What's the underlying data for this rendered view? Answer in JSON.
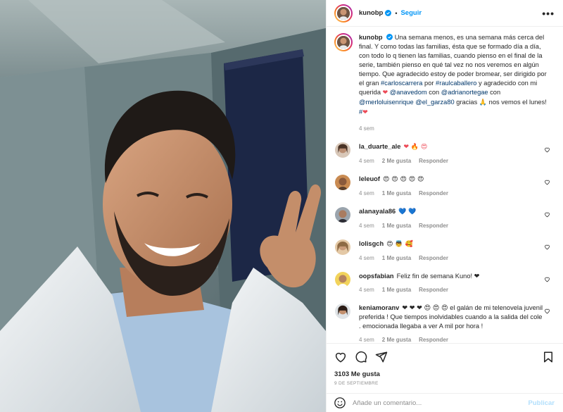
{
  "post": {
    "username": "kunobp",
    "follow_label": "Seguir",
    "separator": "•",
    "more_label": "•••",
    "caption": {
      "text_before": "Una semana menos, es una semana más cerca del final. Y como todas las familias, ésta que se formado día a día, con todo lo q tienen las familias, cuando pienso en el final de la serie, también pienso en qué tal vez no nos veremos en algún tiempo. Que agradecido estoy de poder bromear, ser dirigido por el gran ",
      "mention_1": "#carloscarrera",
      "text_2": " por ",
      "mention_2": "#raulcaballero",
      "text_3": " y agradecido con mi querida ",
      "heart_1": "❤",
      "text_4": "  ",
      "mention_3": "@anavedom",
      "text_5": " con ",
      "mention_4": "@adrianortegae",
      "text_6": " con ",
      "mention_5": "@merloluisenrique",
      "text_7": " ",
      "mention_6": "@el_garza80",
      "text_8": " gracias ",
      "emoji_pray": "🙏",
      "text_9": "  nos vemos el lunes! ",
      "mention_7": "#",
      "heart_2": "❤",
      "time": "4 sem"
    },
    "comments": [
      {
        "user": "la_duarte_ale",
        "text": "❤ 🔥 😍",
        "time": "4 sem",
        "likes": "2 Me gusta",
        "reply": "Responder"
      },
      {
        "user": "leleuof",
        "text": "😍 😍 😍 😍 😍",
        "time": "4 sem",
        "likes": "1 Me gusta",
        "reply": "Responder"
      },
      {
        "user": "alanayala86",
        "text": "💙 💙",
        "time": "4 sem",
        "likes": "1 Me gusta",
        "reply": "Responder"
      },
      {
        "user": "lolisgch",
        "text": "😍 👼 🥰",
        "time": "4 sem",
        "likes": "1 Me gusta",
        "reply": "Responder"
      },
      {
        "user": "oopsfabian",
        "text": "Feliz fin de semana Kuno! ❤",
        "time": "4 sem",
        "likes": "1 Me gusta",
        "reply": "Responder"
      },
      {
        "user": "keniamoranv",
        "text": "❤ ❤ ❤ 😍 😍 😍 el galán de mi telenovela juvenil preferida ! Que tiempos inolvidables cuando a la salida del cole . emocionada llegaba a ver A mil por hora !",
        "time": "4 sem",
        "likes": "2 Me gusta",
        "reply": "Responder"
      }
    ],
    "likes_count": "3103 Me gusta",
    "date": "9 DE SEPTIEMBRE",
    "add_comment_placeholder": "Añade un comentario...",
    "publish_label": "Publicar"
  },
  "colors": {
    "link": "#00376b",
    "follow": "#0095f6",
    "heart": "#ed4956",
    "muted": "#8e8e8e",
    "publish_disabled": "#b2dffc"
  },
  "icons": [
    "heart-icon",
    "comment-icon",
    "share-icon",
    "save-icon",
    "smile-icon",
    "verified-icon",
    "more-icon"
  ]
}
